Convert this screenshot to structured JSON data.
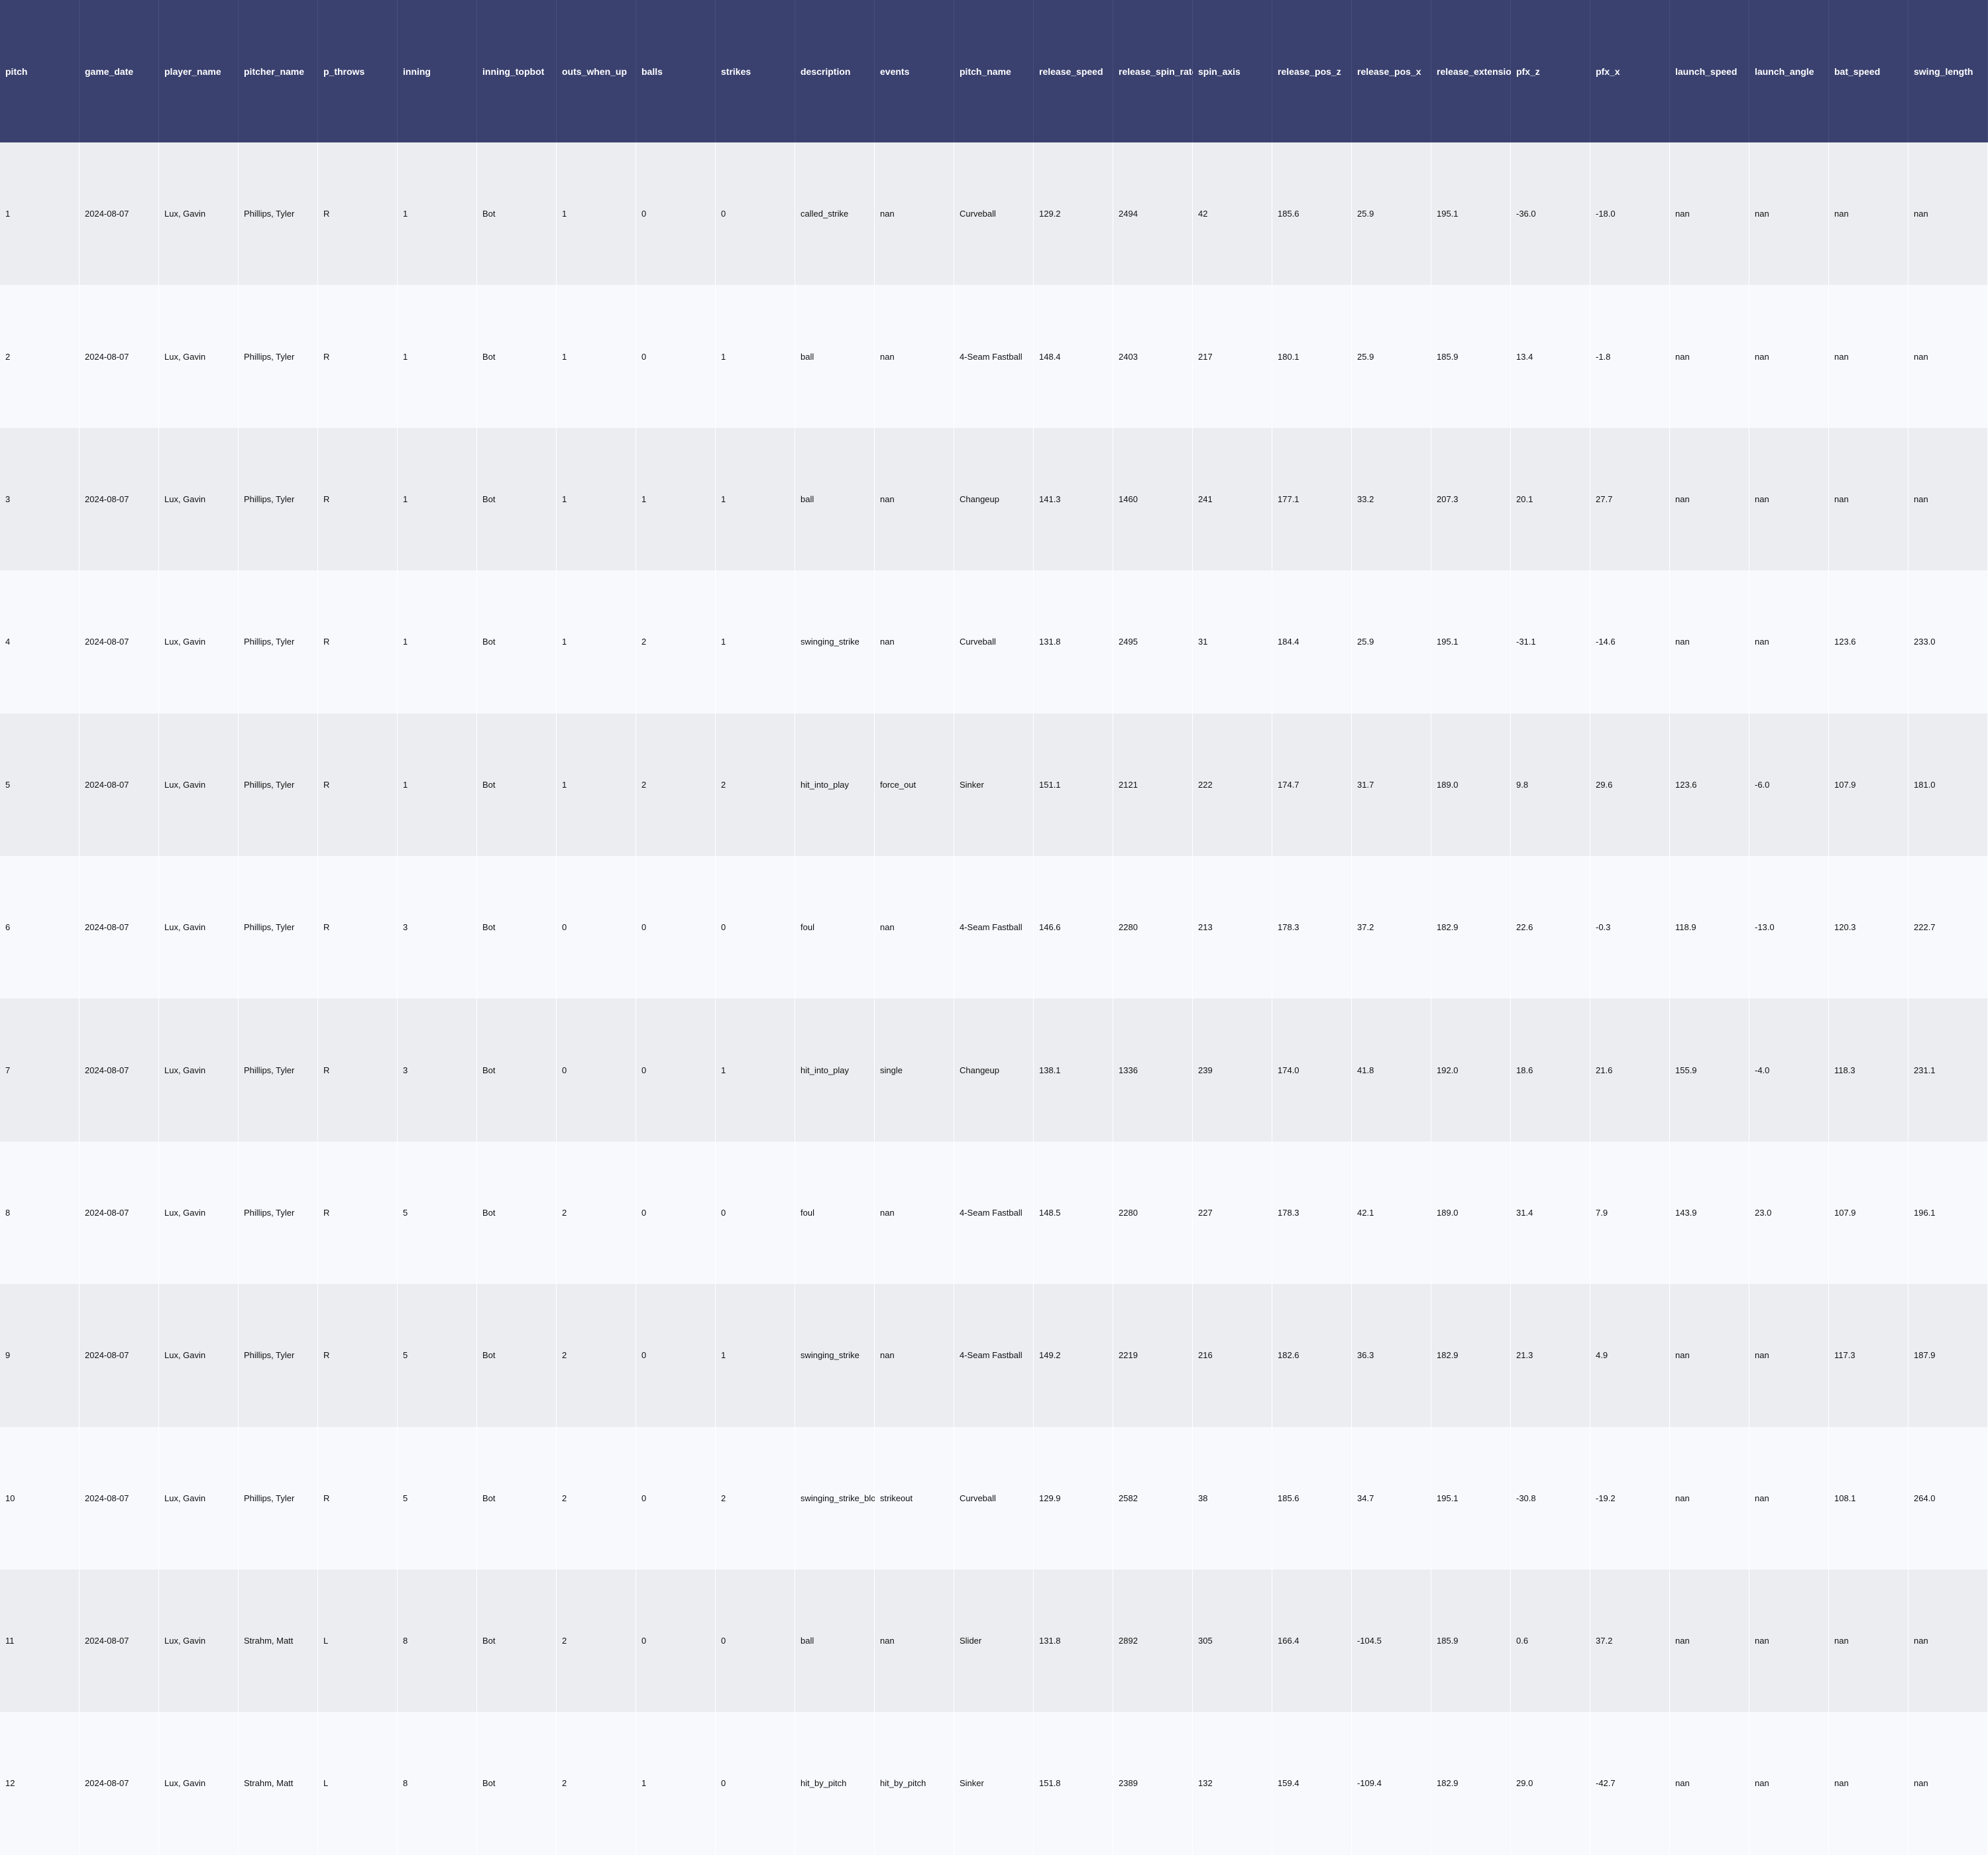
{
  "colors": {
    "header_bg": "#3a416f",
    "header_text": "#ffffff",
    "row_odd": "#ecedf0",
    "row_even": "#f8f9fd"
  },
  "chart_data": {
    "type": "table",
    "columns": [
      "pitch",
      "game_date",
      "player_name",
      "pitcher_name",
      "p_throws",
      "inning",
      "inning_topbot",
      "outs_when_up",
      "balls",
      "strikes",
      "description",
      "events",
      "pitch_name",
      "release_speed",
      "release_spin_rate",
      "spin_axis",
      "release_pos_z",
      "release_pos_x",
      "release_extension",
      "pfx_z",
      "pfx_x",
      "launch_speed",
      "launch_angle",
      "bat_speed",
      "swing_length"
    ],
    "rows": [
      [
        "1",
        "2024-08-07",
        "Lux, Gavin",
        "Phillips, Tyler",
        "R",
        "1",
        "Bot",
        "1",
        "0",
        "0",
        "called_strike",
        "nan",
        "Curveball",
        "129.2",
        "2494",
        "42",
        "185.6",
        "25.9",
        "195.1",
        "-36.0",
        "-18.0",
        "nan",
        "nan",
        "nan",
        "nan"
      ],
      [
        "2",
        "2024-08-07",
        "Lux, Gavin",
        "Phillips, Tyler",
        "R",
        "1",
        "Bot",
        "1",
        "0",
        "1",
        "ball",
        "nan",
        "4-Seam Fastball",
        "148.4",
        "2403",
        "217",
        "180.1",
        "25.9",
        "185.9",
        "13.4",
        "-1.8",
        "nan",
        "nan",
        "nan",
        "nan"
      ],
      [
        "3",
        "2024-08-07",
        "Lux, Gavin",
        "Phillips, Tyler",
        "R",
        "1",
        "Bot",
        "1",
        "1",
        "1",
        "ball",
        "nan",
        "Changeup",
        "141.3",
        "1460",
        "241",
        "177.1",
        "33.2",
        "207.3",
        "20.1",
        "27.7",
        "nan",
        "nan",
        "nan",
        "nan"
      ],
      [
        "4",
        "2024-08-07",
        "Lux, Gavin",
        "Phillips, Tyler",
        "R",
        "1",
        "Bot",
        "1",
        "2",
        "1",
        "swinging_strike",
        "nan",
        "Curveball",
        "131.8",
        "2495",
        "31",
        "184.4",
        "25.9",
        "195.1",
        "-31.1",
        "-14.6",
        "nan",
        "nan",
        "123.6",
        "233.0"
      ],
      [
        "5",
        "2024-08-07",
        "Lux, Gavin",
        "Phillips, Tyler",
        "R",
        "1",
        "Bot",
        "1",
        "2",
        "2",
        "hit_into_play",
        "force_out",
        "Sinker",
        "151.1",
        "2121",
        "222",
        "174.7",
        "31.7",
        "189.0",
        "9.8",
        "29.6",
        "123.6",
        "-6.0",
        "107.9",
        "181.0"
      ],
      [
        "6",
        "2024-08-07",
        "Lux, Gavin",
        "Phillips, Tyler",
        "R",
        "3",
        "Bot",
        "0",
        "0",
        "0",
        "foul",
        "nan",
        "4-Seam Fastball",
        "146.6",
        "2280",
        "213",
        "178.3",
        "37.2",
        "182.9",
        "22.6",
        "-0.3",
        "118.9",
        "-13.0",
        "120.3",
        "222.7"
      ],
      [
        "7",
        "2024-08-07",
        "Lux, Gavin",
        "Phillips, Tyler",
        "R",
        "3",
        "Bot",
        "0",
        "0",
        "1",
        "hit_into_play",
        "single",
        "Changeup",
        "138.1",
        "1336",
        "239",
        "174.0",
        "41.8",
        "192.0",
        "18.6",
        "21.6",
        "155.9",
        "-4.0",
        "118.3",
        "231.1"
      ],
      [
        "8",
        "2024-08-07",
        "Lux, Gavin",
        "Phillips, Tyler",
        "R",
        "5",
        "Bot",
        "2",
        "0",
        "0",
        "foul",
        "nan",
        "4-Seam Fastball",
        "148.5",
        "2280",
        "227",
        "178.3",
        "42.1",
        "189.0",
        "31.4",
        "7.9",
        "143.9",
        "23.0",
        "107.9",
        "196.1"
      ],
      [
        "9",
        "2024-08-07",
        "Lux, Gavin",
        "Phillips, Tyler",
        "R",
        "5",
        "Bot",
        "2",
        "0",
        "1",
        "swinging_strike",
        "nan",
        "4-Seam Fastball",
        "149.2",
        "2219",
        "216",
        "182.6",
        "36.3",
        "182.9",
        "21.3",
        "4.9",
        "nan",
        "nan",
        "117.3",
        "187.9"
      ],
      [
        "10",
        "2024-08-07",
        "Lux, Gavin",
        "Phillips, Tyler",
        "R",
        "5",
        "Bot",
        "2",
        "0",
        "2",
        "swinging_strike_blocked",
        "strikeout",
        "Curveball",
        "129.9",
        "2582",
        "38",
        "185.6",
        "34.7",
        "195.1",
        "-30.8",
        "-19.2",
        "nan",
        "nan",
        "108.1",
        "264.0"
      ],
      [
        "11",
        "2024-08-07",
        "Lux, Gavin",
        "Strahm, Matt",
        "L",
        "8",
        "Bot",
        "2",
        "0",
        "0",
        "ball",
        "nan",
        "Slider",
        "131.8",
        "2892",
        "305",
        "166.4",
        "-104.5",
        "185.9",
        "0.6",
        "37.2",
        "nan",
        "nan",
        "nan",
        "nan"
      ],
      [
        "12",
        "2024-08-07",
        "Lux, Gavin",
        "Strahm, Matt",
        "L",
        "8",
        "Bot",
        "2",
        "1",
        "0",
        "hit_by_pitch",
        "hit_by_pitch",
        "Sinker",
        "151.8",
        "2389",
        "132",
        "159.4",
        "-109.4",
        "182.9",
        "29.0",
        "-42.7",
        "nan",
        "nan",
        "nan",
        "nan"
      ]
    ]
  }
}
